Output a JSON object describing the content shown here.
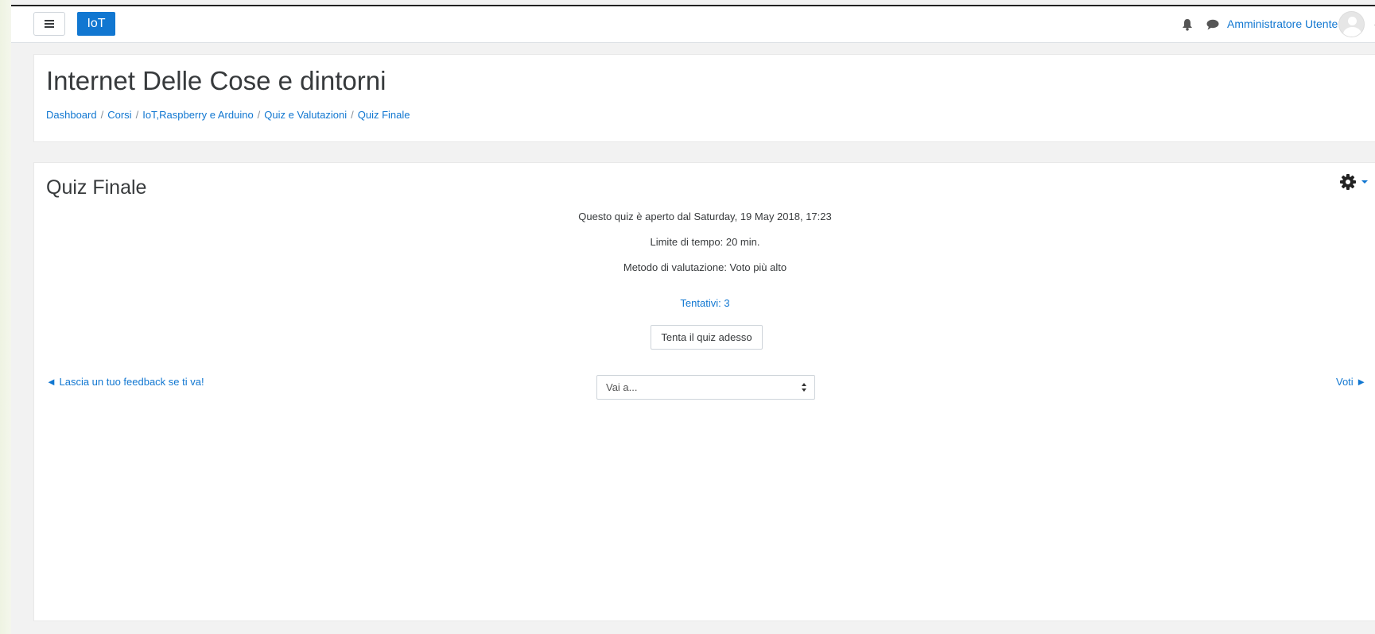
{
  "navbar": {
    "brand": "IoT",
    "user_name": "Amministratore Utente"
  },
  "header": {
    "title": "Internet Delle Cose e dintorni",
    "breadcrumb": [
      "Dashboard",
      "Corsi",
      "IoT,Raspberry e Arduino",
      "Quiz e Valutazioni",
      "Quiz Finale"
    ]
  },
  "quiz": {
    "title": "Quiz Finale",
    "open_info": "Questo quiz è aperto dal Saturday, 19 May 2018, 17:23",
    "time_limit": "Limite di tempo: 20 min.",
    "grading_method": "Metodo di valutazione: Voto più alto",
    "attempts": "Tentativi: 3",
    "attempt_button": "Tenta il quiz adesso"
  },
  "activity_nav": {
    "prev_link": "◄ Lascia un tuo feedback se ti va!",
    "jump_select": "Vai a...",
    "next_link": "Voti ►"
  },
  "colors": {
    "brand": "#1177d1",
    "link": "#1177d1",
    "text": "#373a3c"
  }
}
